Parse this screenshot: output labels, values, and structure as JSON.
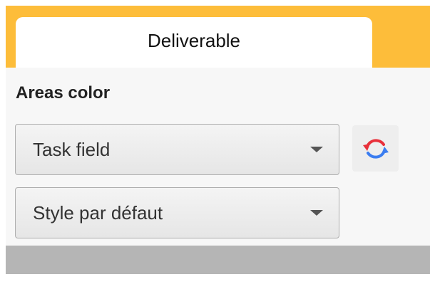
{
  "tabs": {
    "active_label": "Deliverable"
  },
  "section": {
    "title": "Areas color"
  },
  "dropdowns": {
    "field": {
      "value": "Task field"
    },
    "style": {
      "value": "Style par défaut"
    }
  },
  "colors": {
    "ribbon": "#fdbd3a",
    "refresh_red": "#e8303a",
    "refresh_blue": "#3b7df0"
  },
  "icons": {
    "refresh": "refresh-icon",
    "dropdown_arrow": "chevron-down-icon"
  }
}
